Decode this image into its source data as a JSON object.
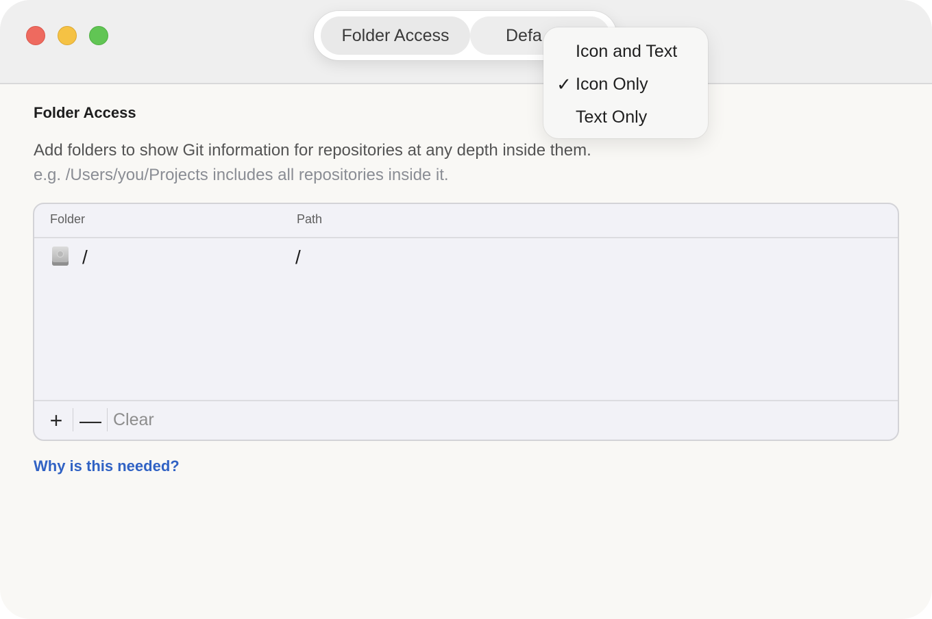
{
  "window": {
    "traffic_lights": {
      "close_color": "#ee6a5f",
      "minimize_color": "#f5c244",
      "maximize_color": "#61c554"
    }
  },
  "toolbar": {
    "segments": [
      {
        "label": "Folder Access",
        "selected": true
      },
      {
        "label": "Defa",
        "selected": false
      }
    ]
  },
  "menu": {
    "items": [
      {
        "label": "Icon and Text",
        "checked": false
      },
      {
        "label": "Icon Only",
        "checked": true,
        "check": "✓"
      },
      {
        "label": "Text Only",
        "checked": false
      }
    ]
  },
  "content": {
    "title": "Folder Access",
    "description": "Add folders to show Git information for repositories at any depth inside them.",
    "hint": "e.g. /Users/you/Projects includes all repositories inside it.",
    "table": {
      "columns": [
        "Folder",
        "Path"
      ],
      "rows": [
        {
          "icon": "drive-icon",
          "folder": "/",
          "path": "/"
        }
      ],
      "footer": {
        "add": "+",
        "remove": "—",
        "clear": "Clear"
      }
    },
    "help_link": "Why is this needed?",
    "accent_color": "#3062c4"
  }
}
